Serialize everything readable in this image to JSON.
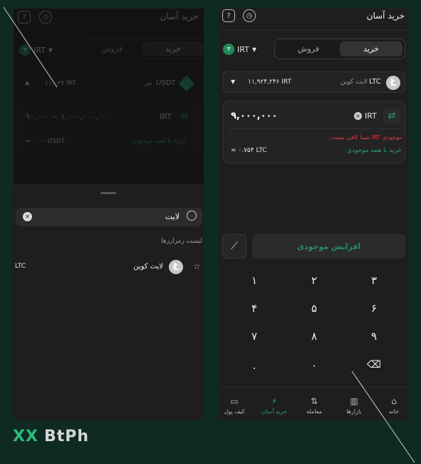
{
  "brand": {
    "mark": "XX",
    "name": "BtPh"
  },
  "left": {
    "header_title": "خرید آسان",
    "tabs": {
      "buy": "خرید",
      "sell": "فروش"
    },
    "currency": "IRT",
    "asset_row": {
      "name": "USDT",
      "sub": "تتر",
      "balance": "۱۱,۰۲۷ IRT"
    },
    "amount_hint": "۹۰,۰۰۰ ~ ۱,۰۰۰,۰۰۰,۰۰۰",
    "amount_currency": "IRT",
    "converted": "≈ ۰.۰۰ USDT",
    "buy_all": "خرید با همه موجودی",
    "search_value": "لایت",
    "list_title": "لیست رمزارزها",
    "result": {
      "name": "لایت کوین",
      "symbol": "LTC",
      "icon": "litecoin-icon"
    }
  },
  "right": {
    "header_title": "خرید آسان",
    "tabs": {
      "buy": "خرید",
      "sell": "فروش"
    },
    "currency": "IRT",
    "asset_row": {
      "symbol": "LTC",
      "name": "لایت کوین",
      "balance": "۱۱,۹۲۴,۲۴۶ IRT"
    },
    "amount_value": "۹,۰۰۰,۰۰۰",
    "amount_currency": "IRT",
    "error": "موجودی IRT شما کافی نیست.",
    "buy_all": "خرید با همه موجودی",
    "converted": "≈ ۰.۷۵۴ LTC",
    "topup_button": "افزایش موجودی",
    "keypad": [
      "۳",
      "۲",
      "۱",
      "۶",
      "۵",
      "۴",
      "۹",
      "۸",
      "۷",
      "",
      "۰",
      "."
    ],
    "nav": [
      {
        "label": "خانه",
        "icon": "home-icon"
      },
      {
        "label": "بازارها",
        "icon": "markets-icon"
      },
      {
        "label": "معامله",
        "icon": "trade-icon"
      },
      {
        "label": "خرید آسان",
        "icon": "bolt-icon"
      },
      {
        "label": "کیف پول",
        "icon": "wallet-icon"
      }
    ]
  },
  "colors": {
    "accent": "#29a36a",
    "error": "#e03c3c",
    "background": "#0f2a23",
    "panel": "#1e1e1e"
  }
}
